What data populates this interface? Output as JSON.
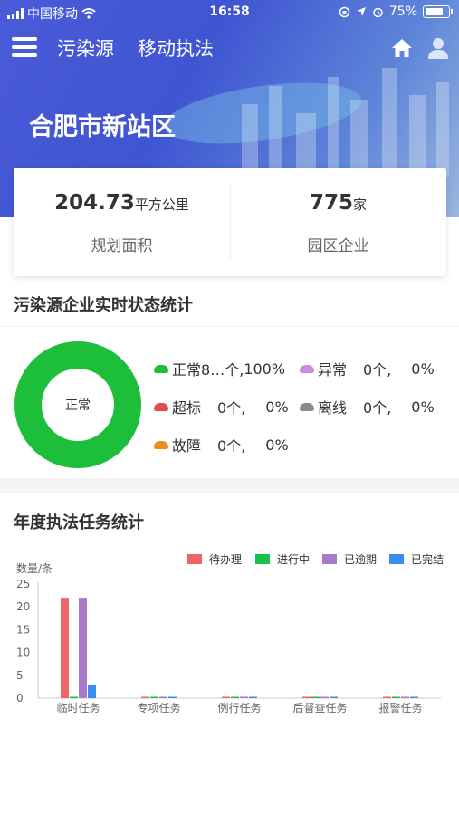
{
  "status_bar": {
    "carrier": "中国移动",
    "time": "16:58",
    "battery": "75%"
  },
  "nav": {
    "tabs": [
      "污染源",
      "移动执法"
    ]
  },
  "district": "合肥市新站区",
  "summary": [
    {
      "value": "204.73",
      "unit": "平方公里",
      "label": "规划面积"
    },
    {
      "value": "775",
      "unit": "家",
      "label": "园区企业"
    }
  ],
  "status_section": {
    "title": "污染源企业实时状态统计",
    "donut_label": "正常",
    "legend": [
      {
        "name": "正常",
        "count": "8…个,",
        "percent": "100%",
        "color": "#1dbf3a"
      },
      {
        "name": "异常",
        "count": "0个,",
        "percent": "0%",
        "color": "#c98ee0"
      },
      {
        "name": "超标",
        "count": "0个,",
        "percent": "0%",
        "color": "#e04b4b"
      },
      {
        "name": "离线",
        "count": "0个,",
        "percent": "0%",
        "color": "#8a8a8a"
      },
      {
        "name": "故障",
        "count": "0个,",
        "percent": "0%",
        "color": "#e89020"
      }
    ],
    "normal_fraction": 1.0
  },
  "task_section": {
    "title": "年度执法任务统计"
  },
  "chart_data": {
    "type": "bar",
    "ylabel": "数量/条",
    "ylim": [
      0,
      25
    ],
    "yticks": [
      0,
      5,
      10,
      15,
      20,
      25
    ],
    "categories": [
      "临时任务",
      "专项任务",
      "例行任务",
      "后督查任务",
      "报警任务"
    ],
    "series": [
      {
        "name": "待办理",
        "color": "#ee6466",
        "values": [
          22,
          0,
          0,
          0,
          0
        ]
      },
      {
        "name": "进行中",
        "color": "#17c14a",
        "values": [
          0,
          0,
          0,
          0,
          0
        ]
      },
      {
        "name": "已逾期",
        "color": "#a77bc8",
        "values": [
          22,
          0,
          0,
          0,
          0
        ]
      },
      {
        "name": "已完结",
        "color": "#3a8ef0",
        "values": [
          3,
          0,
          0,
          0,
          0
        ]
      }
    ]
  }
}
